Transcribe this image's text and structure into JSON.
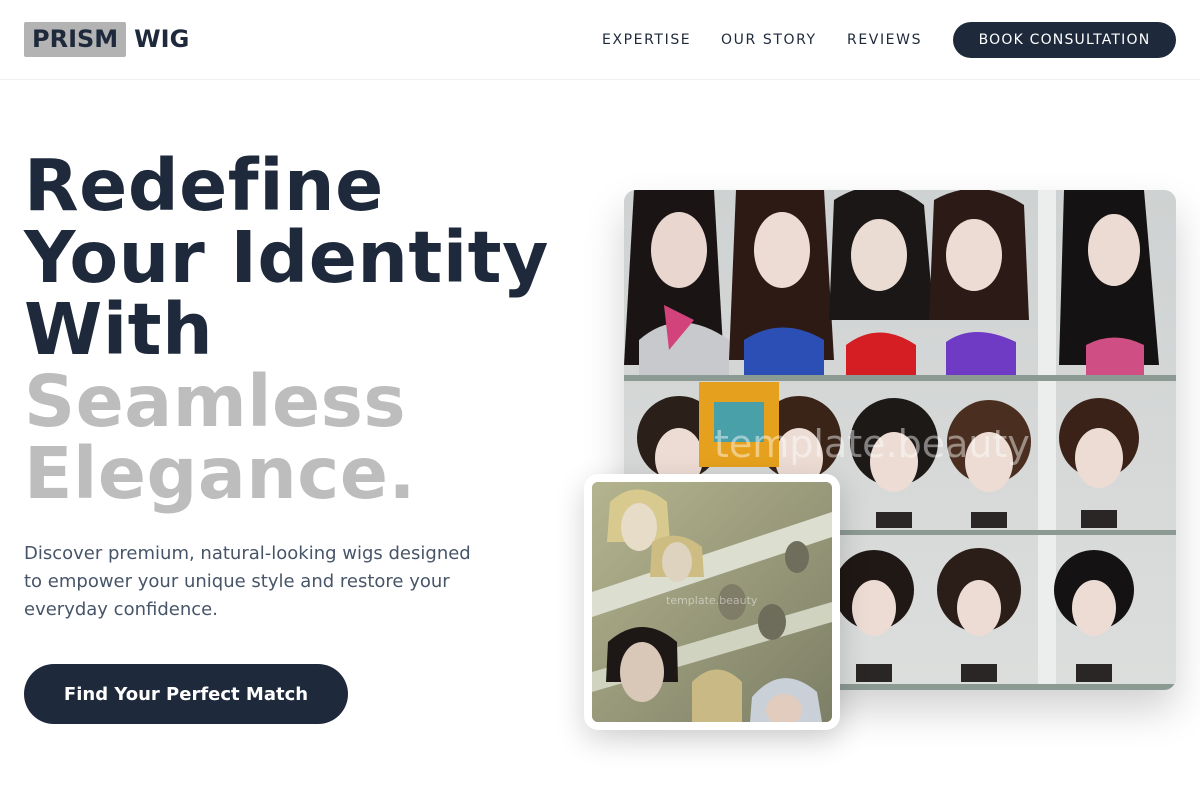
{
  "header": {
    "logo_box": "PRISM",
    "logo_text": "WIG",
    "nav": [
      {
        "label": "EXPERTISE"
      },
      {
        "label": "OUR STORY"
      },
      {
        "label": "REVIEWS"
      }
    ],
    "cta_label": "BOOK CONSULTATION"
  },
  "hero": {
    "title_lines": [
      "Redefine",
      "Your Identity",
      "With"
    ],
    "title_muted_lines": [
      "Seamless",
      "Elegance."
    ],
    "description": "Discover premium, natural-looking wigs designed to empower your unique style and restore your everyday confidence.",
    "cta_label": "Find Your Perfect Match"
  },
  "images": {
    "main_watermark": "template.beauty",
    "inset_watermark": "template.beauty"
  },
  "colors": {
    "primary": "#1e293b",
    "muted_heading": "#bdbdbd",
    "logo_box_bg": "#b3b3b3"
  }
}
